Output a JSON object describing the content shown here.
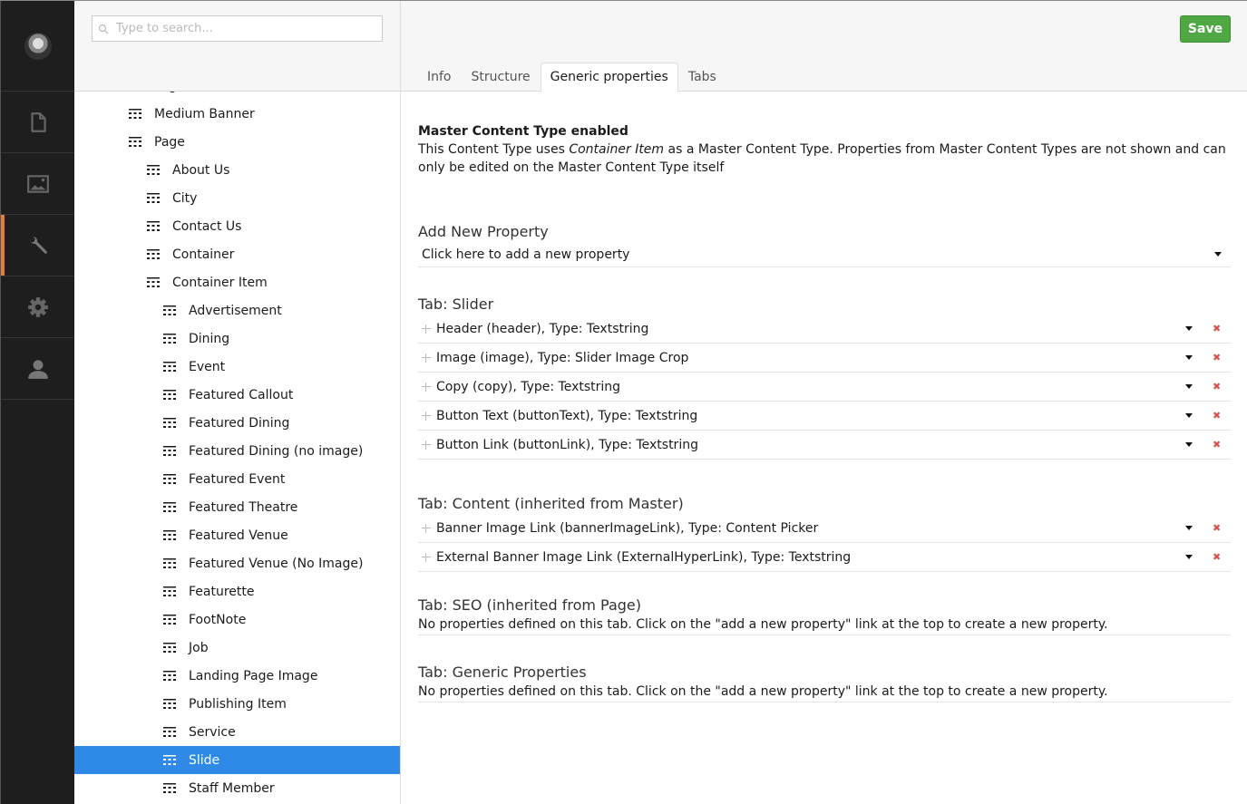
{
  "rail": {
    "items": [
      {
        "name": "content",
        "icon": "document-icon",
        "active": false
      },
      {
        "name": "media",
        "icon": "image-icon",
        "active": false
      },
      {
        "name": "settings",
        "icon": "wrench-icon",
        "active": true
      },
      {
        "name": "developer",
        "icon": "gear-icon",
        "active": false
      },
      {
        "name": "users",
        "icon": "user-icon",
        "active": false
      }
    ],
    "accent_color": "#e37f3c"
  },
  "tree": {
    "search_placeholder": "Type to search...",
    "items": [
      {
        "label": "Medium Banner",
        "level": 0
      },
      {
        "label": "Page",
        "level": 0
      },
      {
        "label": "About Us",
        "level": 1
      },
      {
        "label": "City",
        "level": 1
      },
      {
        "label": "Contact Us",
        "level": 1
      },
      {
        "label": "Container",
        "level": 1
      },
      {
        "label": "Container Item",
        "level": 1
      },
      {
        "label": "Advertisement",
        "level": 2
      },
      {
        "label": "Dining",
        "level": 2
      },
      {
        "label": "Event",
        "level": 2
      },
      {
        "label": "Featured Callout",
        "level": 2
      },
      {
        "label": "Featured Dining",
        "level": 2
      },
      {
        "label": "Featured Dining (no image)",
        "level": 2
      },
      {
        "label": "Featured Event",
        "level": 2
      },
      {
        "label": "Featured Theatre",
        "level": 2
      },
      {
        "label": "Featured Venue",
        "level": 2
      },
      {
        "label": "Featured Venue (No Image)",
        "level": 2
      },
      {
        "label": "Featurette",
        "level": 2
      },
      {
        "label": "FootNote",
        "level": 2
      },
      {
        "label": "Job",
        "level": 2
      },
      {
        "label": "Landing Page Image",
        "level": 2
      },
      {
        "label": "Publishing Item",
        "level": 2
      },
      {
        "label": "Service",
        "level": 2
      },
      {
        "label": "Slide",
        "level": 2,
        "selected": true
      },
      {
        "label": "Staff Member",
        "level": 2
      }
    ],
    "selected_color": "#2e8ae6"
  },
  "header": {
    "save_label": "Save",
    "save_color": "#50a845",
    "tabs": [
      {
        "label": "Info",
        "active": false
      },
      {
        "label": "Structure",
        "active": false
      },
      {
        "label": "Generic properties",
        "active": true
      },
      {
        "label": "Tabs",
        "active": false
      }
    ]
  },
  "content": {
    "notice": {
      "title": "Master Content Type enabled",
      "text_before": "This Content Type uses ",
      "master_name": "Container Item",
      "text_after": " as a Master Content Type. Properties from Master Content Types are not shown and can only be edited on the Master Content Type itself"
    },
    "add_property": {
      "title": "Add New Property",
      "placeholder": "Click here to add a new property"
    },
    "groups": [
      {
        "title": "Tab: Slider",
        "properties": [
          "Header (header), Type: Textstring",
          "Image (image), Type: Slider Image Crop",
          "Copy (copy), Type: Textstring",
          "Button Text (buttonText), Type: Textstring",
          "Button Link (buttonLink), Type: Textstring"
        ]
      },
      {
        "title": "Tab: Content (inherited from Master)",
        "properties": [
          "Banner Image Link (bannerImageLink), Type: Content Picker",
          "External Banner Image Link (ExternalHyperLink), Type: Textstring"
        ]
      },
      {
        "title": "Tab: SEO (inherited from Page)",
        "empty_text": "No properties defined on this tab. Click on the \"add a new property\" link at the top to create a new property."
      },
      {
        "title": "Tab: Generic Properties",
        "empty_text": "No properties defined on this tab. Click on the \"add a new property\" link at the top to create a new property."
      }
    ],
    "delete_color": "#d9534f"
  }
}
